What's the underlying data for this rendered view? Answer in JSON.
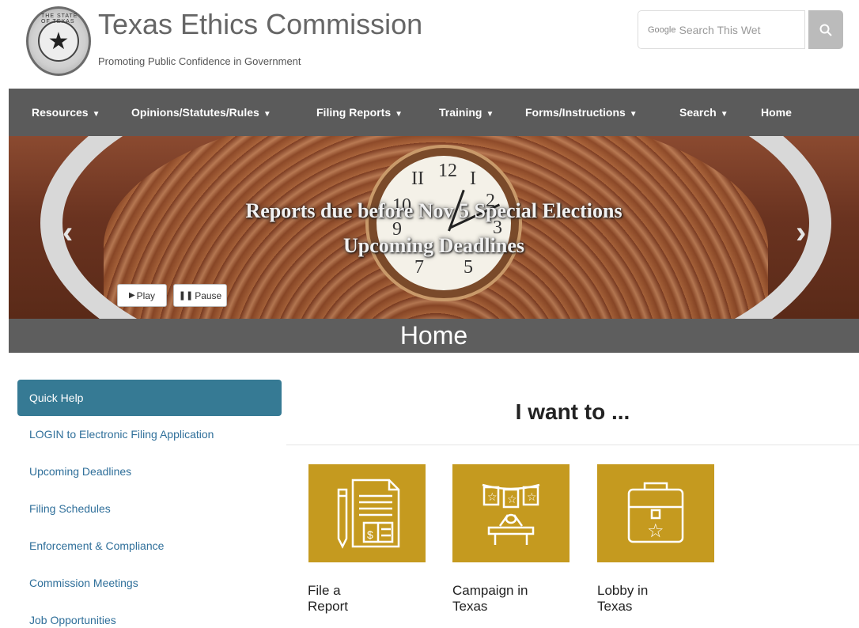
{
  "header": {
    "seal_text": "THE STATE OF TEXAS",
    "title": "Texas Ethics Commission",
    "tagline": "Promoting Public Confidence in Government",
    "search": {
      "brand": "Google",
      "placeholder": "Search This Wet"
    }
  },
  "nav": {
    "items": [
      {
        "label": "Resources",
        "dropdown": true
      },
      {
        "label": "Opinions/Statutes/Rules",
        "dropdown": true
      },
      {
        "label": "Filing Reports",
        "dropdown": true
      },
      {
        "label": "Training",
        "dropdown": true
      },
      {
        "label": "Forms/Instructions",
        "dropdown": true
      },
      {
        "label": "Search",
        "dropdown": true
      },
      {
        "label": "Home",
        "dropdown": false
      }
    ]
  },
  "hero": {
    "line1": "Reports due before Nov 5 Special Elections",
    "line2": "Upcoming Deadlines",
    "play_label": "Play",
    "pause_label": "Pause",
    "prev_icon": "chevron-left-icon",
    "next_icon": "chevron-right-icon"
  },
  "page_title": "Home",
  "sidebar": {
    "heading": "Quick Help",
    "links": [
      "LOGIN to Electronic Filing Application",
      "Upcoming Deadlines",
      "Filing Schedules",
      "Enforcement & Compliance",
      "Commission Meetings",
      "Job Opportunities"
    ]
  },
  "main": {
    "heading": "I want to ...",
    "tiles": [
      {
        "line1": "File a",
        "line2": "Report",
        "icon": "report-document-icon"
      },
      {
        "line1": "Campaign in",
        "line2": "Texas",
        "icon": "campaign-podium-icon"
      },
      {
        "line1": "Lobby in",
        "line2": "Texas",
        "icon": "briefcase-star-icon"
      }
    ]
  },
  "colors": {
    "nav_bg": "#5b5b5b",
    "quick_help_bg": "#367a94",
    "link": "#2f6f9a",
    "tile_gold": "#c59a1f"
  }
}
